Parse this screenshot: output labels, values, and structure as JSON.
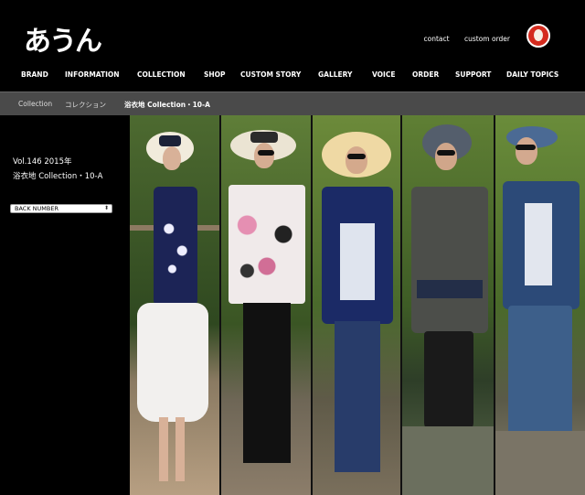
{
  "header": {
    "logo_text": "あうん",
    "links": [
      "contact",
      "custom order"
    ]
  },
  "nav": {
    "items": [
      "BRAND",
      "INFORMATION",
      "COLLECTION",
      "SHOP",
      "CUSTOM STORY",
      "GALLERY",
      "VOICE",
      "ORDER",
      "SUPPORT",
      "DAILY TOPICS"
    ]
  },
  "breadcrumb": {
    "items": [
      "Collection",
      "コレクション",
      "浴衣地 Collection・10-A"
    ]
  },
  "sidebar": {
    "volume": "Vol.146  2015年",
    "subtitle": "浴衣地 Collection・10-A",
    "back_number": "BACK NUMBER",
    "back_number_arrow": "⬍"
  },
  "colors": {
    "background": "#000000",
    "breadcrumb_bar": "#4a4a4a",
    "seal_red": "#d42b1e"
  }
}
